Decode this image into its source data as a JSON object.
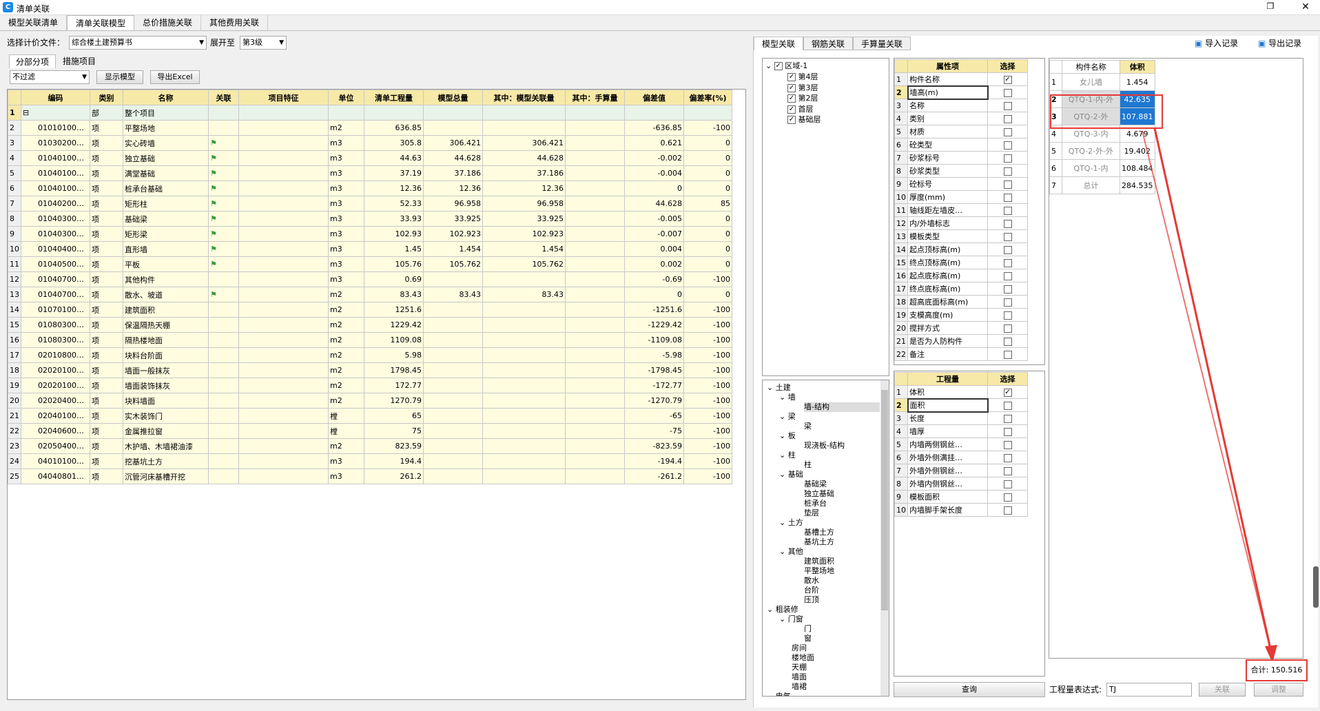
{
  "window": {
    "title": "清单关联",
    "restore_glyph": "❐",
    "close_glyph": "✕"
  },
  "main_tabs": [
    "模型关联清单",
    "清单关联模型",
    "总价措施关联",
    "其他费用关联"
  ],
  "left": {
    "file_label": "选择计价文件：",
    "file_value": "综合楼土建预算书",
    "expand_label": "展开至",
    "expand_value": "第3级",
    "sub_tabs": [
      "分部分项",
      "措施项目"
    ],
    "filter_value": "不过滤",
    "show_model_btn": "显示模型",
    "export_btn": "导出Excel",
    "columns": [
      "编码",
      "类别",
      "名称",
      "关联",
      "项目特征",
      "单位",
      "清单工程量",
      "模型总量",
      "其中：模型关联量",
      "其中：手算量",
      "偏差值",
      "偏差率(%)"
    ],
    "rows": [
      [
        "1",
        "⊟",
        "部",
        "整个项目",
        "",
        "",
        "",
        "",
        "",
        "",
        "",
        "",
        ""
      ],
      [
        "2",
        "01010100…",
        "项",
        "平整场地",
        "",
        "",
        "m2",
        "636.85",
        "",
        "",
        "",
        "-636.85",
        "-100"
      ],
      [
        "3",
        "01030200…",
        "项",
        "实心砖墙",
        "⚑",
        "",
        "m3",
        "305.8",
        "306.421",
        "306.421",
        "",
        "0.621",
        "0"
      ],
      [
        "4",
        "01040100…",
        "项",
        "独立基础",
        "⚑",
        "",
        "m3",
        "44.63",
        "44.628",
        "44.628",
        "",
        "-0.002",
        "0"
      ],
      [
        "5",
        "01040100…",
        "项",
        "满堂基础",
        "⚑",
        "",
        "m3",
        "37.19",
        "37.186",
        "37.186",
        "",
        "-0.004",
        "0"
      ],
      [
        "6",
        "01040100…",
        "项",
        "桩承台基础",
        "⚑",
        "",
        "m3",
        "12.36",
        "12.36",
        "12.36",
        "",
        "0",
        "0"
      ],
      [
        "7",
        "01040200…",
        "项",
        "矩形柱",
        "⚑",
        "",
        "m3",
        "52.33",
        "96.958",
        "96.958",
        "",
        "44.628",
        "85"
      ],
      [
        "8",
        "01040300…",
        "项",
        "基础梁",
        "⚑",
        "",
        "m3",
        "33.93",
        "33.925",
        "33.925",
        "",
        "-0.005",
        "0"
      ],
      [
        "9",
        "01040300…",
        "项",
        "矩形梁",
        "⚑",
        "",
        "m3",
        "102.93",
        "102.923",
        "102.923",
        "",
        "-0.007",
        "0"
      ],
      [
        "10",
        "01040400…",
        "项",
        "直形墙",
        "⚑",
        "",
        "m3",
        "1.45",
        "1.454",
        "1.454",
        "",
        "0.004",
        "0"
      ],
      [
        "11",
        "01040500…",
        "项",
        "平板",
        "⚑",
        "",
        "m3",
        "105.76",
        "105.762",
        "105.762",
        "",
        "0.002",
        "0"
      ],
      [
        "12",
        "01040700…",
        "项",
        "其他构件",
        "",
        "",
        "m3",
        "0.69",
        "",
        "",
        "",
        "-0.69",
        "-100"
      ],
      [
        "13",
        "01040700…",
        "项",
        "散水、坡道",
        "⚑",
        "",
        "m2",
        "83.43",
        "83.43",
        "83.43",
        "",
        "0",
        "0"
      ],
      [
        "14",
        "01070100…",
        "项",
        "建筑面积",
        "",
        "",
        "m2",
        "1251.6",
        "",
        "",
        "",
        "-1251.6",
        "-100"
      ],
      [
        "15",
        "01080300…",
        "项",
        "保温隔热天棚",
        "",
        "",
        "m2",
        "1229.42",
        "",
        "",
        "",
        "-1229.42",
        "-100"
      ],
      [
        "16",
        "01080300…",
        "项",
        "隔热楼地面",
        "",
        "",
        "m2",
        "1109.08",
        "",
        "",
        "",
        "-1109.08",
        "-100"
      ],
      [
        "17",
        "02010800…",
        "项",
        "块料台阶面",
        "",
        "",
        "m2",
        "5.98",
        "",
        "",
        "",
        "-5.98",
        "-100"
      ],
      [
        "18",
        "02020100…",
        "项",
        "墙面一般抹灰",
        "",
        "",
        "m2",
        "1798.45",
        "",
        "",
        "",
        "-1798.45",
        "-100"
      ],
      [
        "19",
        "02020100…",
        "项",
        "墙面装饰抹灰",
        "",
        "",
        "m2",
        "172.77",
        "",
        "",
        "",
        "-172.77",
        "-100"
      ],
      [
        "20",
        "02020400…",
        "项",
        "块料墙面",
        "",
        "",
        "m2",
        "1270.79",
        "",
        "",
        "",
        "-1270.79",
        "-100"
      ],
      [
        "21",
        "02040100…",
        "项",
        "实木装饰门",
        "",
        "",
        "樘",
        "65",
        "",
        "",
        "",
        "-65",
        "-100"
      ],
      [
        "22",
        "02040600…",
        "项",
        "金属推拉窗",
        "",
        "",
        "樘",
        "75",
        "",
        "",
        "",
        "-75",
        "-100"
      ],
      [
        "23",
        "02050400…",
        "项",
        "木护墙、木墙裙油漆",
        "",
        "",
        "m2",
        "823.59",
        "",
        "",
        "",
        "-823.59",
        "-100"
      ],
      [
        "24",
        "04010100…",
        "项",
        "挖基坑土方",
        "",
        "",
        "m3",
        "194.4",
        "",
        "",
        "",
        "-194.4",
        "-100"
      ],
      [
        "25",
        "04040801…",
        "项",
        "沉管河床基槽开挖",
        "",
        "",
        "m3",
        "261.2",
        "",
        "",
        "",
        "-261.2",
        "-100"
      ]
    ]
  },
  "right": {
    "tabs": [
      "模型关联",
      "钢筋关联",
      "手算量关联"
    ],
    "import_btn": "导入记录",
    "export_btn": "导出记录",
    "floors": {
      "root": "区域-1",
      "items": [
        "第4层",
        "第3层",
        "第2层",
        "首层",
        "基础层"
      ]
    },
    "props": {
      "col_name": "属性项",
      "col_sel": "选择",
      "rows": [
        [
          "构件名称",
          true
        ],
        [
          "墙高(m)",
          false
        ],
        [
          "名称",
          false
        ],
        [
          "类别",
          false
        ],
        [
          "材质",
          false
        ],
        [
          "砼类型",
          false
        ],
        [
          "砂浆标号",
          false
        ],
        [
          "砂浆类型",
          false
        ],
        [
          "砼标号",
          false
        ],
        [
          "厚度(mm)",
          false
        ],
        [
          "轴线距左墙皮…",
          false
        ],
        [
          "内/外墙标志",
          false
        ],
        [
          "模板类型",
          false
        ],
        [
          "起点顶标高(m)",
          false
        ],
        [
          "终点顶标高(m)",
          false
        ],
        [
          "起点底标高(m)",
          false
        ],
        [
          "终点底标高(m)",
          false
        ],
        [
          "超高底面标高(m)",
          false
        ],
        [
          "支模高度(m)",
          false
        ],
        [
          "搅拌方式",
          false
        ],
        [
          "是否为人防构件",
          false
        ],
        [
          "备注",
          false
        ]
      ]
    },
    "qty": {
      "col_name": "工程量",
      "col_sel": "选择",
      "rows": [
        [
          "体积",
          true
        ],
        [
          "面积",
          false
        ],
        [
          "长度",
          false
        ],
        [
          "墙厚",
          false
        ],
        [
          "内墙两侧钢丝…",
          false
        ],
        [
          "外墙外侧满挂…",
          false
        ],
        [
          "外墙外侧钢丝…",
          false
        ],
        [
          "外墙内侧钢丝…",
          false
        ],
        [
          "模板面积",
          false
        ],
        [
          "内墙脚手架长度",
          false
        ]
      ]
    },
    "type_tree": [
      {
        "t": "⌄ 土建",
        "l": 0
      },
      {
        "t": "⌄ 墙",
        "l": 1
      },
      {
        "t": "墙-结构",
        "l": 3,
        "sel": true
      },
      {
        "t": "⌄ 梁",
        "l": 1
      },
      {
        "t": "梁",
        "l": 3
      },
      {
        "t": "⌄ 板",
        "l": 1
      },
      {
        "t": "现浇板-结构",
        "l": 3
      },
      {
        "t": "⌄ 柱",
        "l": 1
      },
      {
        "t": "柱",
        "l": 3
      },
      {
        "t": "⌄ 基础",
        "l": 1
      },
      {
        "t": "基础梁",
        "l": 3
      },
      {
        "t": "独立基础",
        "l": 3
      },
      {
        "t": "桩承台",
        "l": 3
      },
      {
        "t": "垫层",
        "l": 3
      },
      {
        "t": "⌄ 土方",
        "l": 1
      },
      {
        "t": "基槽土方",
        "l": 3
      },
      {
        "t": "基坑土方",
        "l": 3
      },
      {
        "t": "⌄ 其他",
        "l": 1
      },
      {
        "t": "建筑面积",
        "l": 3
      },
      {
        "t": "平整场地",
        "l": 3
      },
      {
        "t": "散水",
        "l": 3
      },
      {
        "t": "台阶",
        "l": 3
      },
      {
        "t": "压顶",
        "l": 3
      },
      {
        "t": "⌄ 粗装修",
        "l": 0
      },
      {
        "t": "⌄ 门窗",
        "l": 1
      },
      {
        "t": "门",
        "l": 3
      },
      {
        "t": "窗",
        "l": 3
      },
      {
        "t": "房间",
        "l": 2
      },
      {
        "t": "楼地面",
        "l": 2
      },
      {
        "t": "天棚",
        "l": 2
      },
      {
        "t": "墙面",
        "l": 2
      },
      {
        "t": "墙裙",
        "l": 2
      },
      {
        "t": "⌄ 电气",
        "l": 0
      }
    ],
    "components": {
      "col_name": "构件名称",
      "col_vol": "体积",
      "rows": [
        [
          "1",
          "女儿墙",
          "1.454",
          false
        ],
        [
          "2",
          "QTQ-1-内-外",
          "42.635",
          true
        ],
        [
          "3",
          "QTQ-2-外",
          "107.881",
          true
        ],
        [
          "4",
          "QTQ-3-内",
          "4.679",
          false
        ],
        [
          "5",
          "QTQ-2-外-外",
          "19.402",
          false
        ],
        [
          "6",
          "QTQ-1-内",
          "108.484",
          false
        ],
        [
          "7",
          "总计",
          "284.535",
          false
        ]
      ]
    },
    "sum_label": "合计: 150.516",
    "query_btn": "查询",
    "expr_label": "工程量表达式:",
    "expr_value": "TJ",
    "link_btn": "关联",
    "adjust_btn": "调整"
  }
}
